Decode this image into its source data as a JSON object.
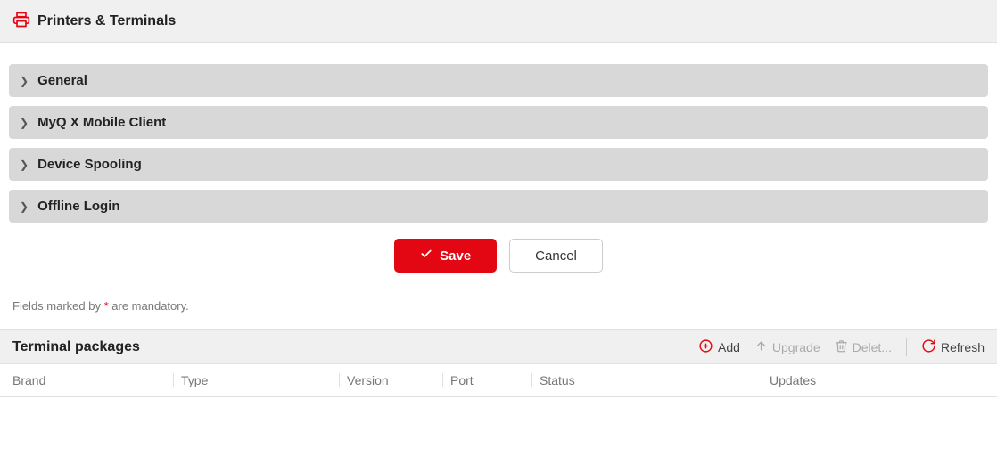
{
  "header": {
    "title": "Printers & Terminals"
  },
  "panels": [
    {
      "title": "General"
    },
    {
      "title": "MyQ X Mobile Client"
    },
    {
      "title": "Device Spooling"
    },
    {
      "title": "Offline Login"
    }
  ],
  "buttons": {
    "save": "Save",
    "cancel": "Cancel"
  },
  "note": {
    "prefix": "Fields marked by ",
    "asterisk": "*",
    "suffix": " are mandatory."
  },
  "section": {
    "title": "Terminal packages",
    "toolbar": {
      "add": "Add",
      "upgrade": "Upgrade",
      "delete": "Delet...",
      "refresh": "Refresh"
    },
    "columns": {
      "brand": "Brand",
      "type": "Type",
      "version": "Version",
      "port": "Port",
      "status": "Status",
      "updates": "Updates"
    }
  }
}
